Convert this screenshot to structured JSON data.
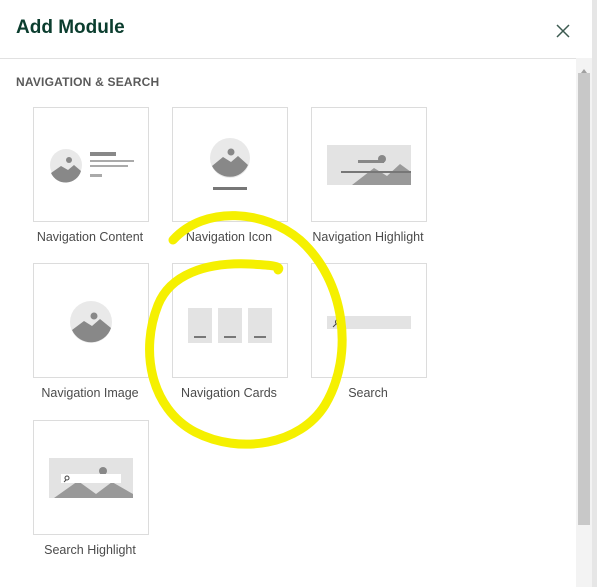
{
  "dialog": {
    "title": "Add Module",
    "close_icon": "close-icon"
  },
  "section": {
    "title": "NAVIGATION & SEARCH"
  },
  "modules": [
    {
      "label": "Navigation Content",
      "icon": "navigation-content-thumbnail-icon"
    },
    {
      "label": "Navigation Icon",
      "icon": "navigation-icon-thumbnail-icon"
    },
    {
      "label": "Navigation Highlight",
      "icon": "navigation-highlight-thumbnail-icon"
    },
    {
      "label": "Navigation Image",
      "icon": "navigation-image-thumbnail-icon"
    },
    {
      "label": "Navigation Cards",
      "icon": "navigation-cards-thumbnail-icon"
    },
    {
      "label": "Search",
      "icon": "search-thumbnail-icon"
    },
    {
      "label": "Search Highlight",
      "icon": "search-highlight-thumbnail-icon"
    }
  ],
  "annotation": {
    "color": "#f5f000",
    "marks": "Navigation Cards"
  },
  "colors": {
    "title": "#0b3d2e",
    "thumbnail_gray": "#999999"
  }
}
